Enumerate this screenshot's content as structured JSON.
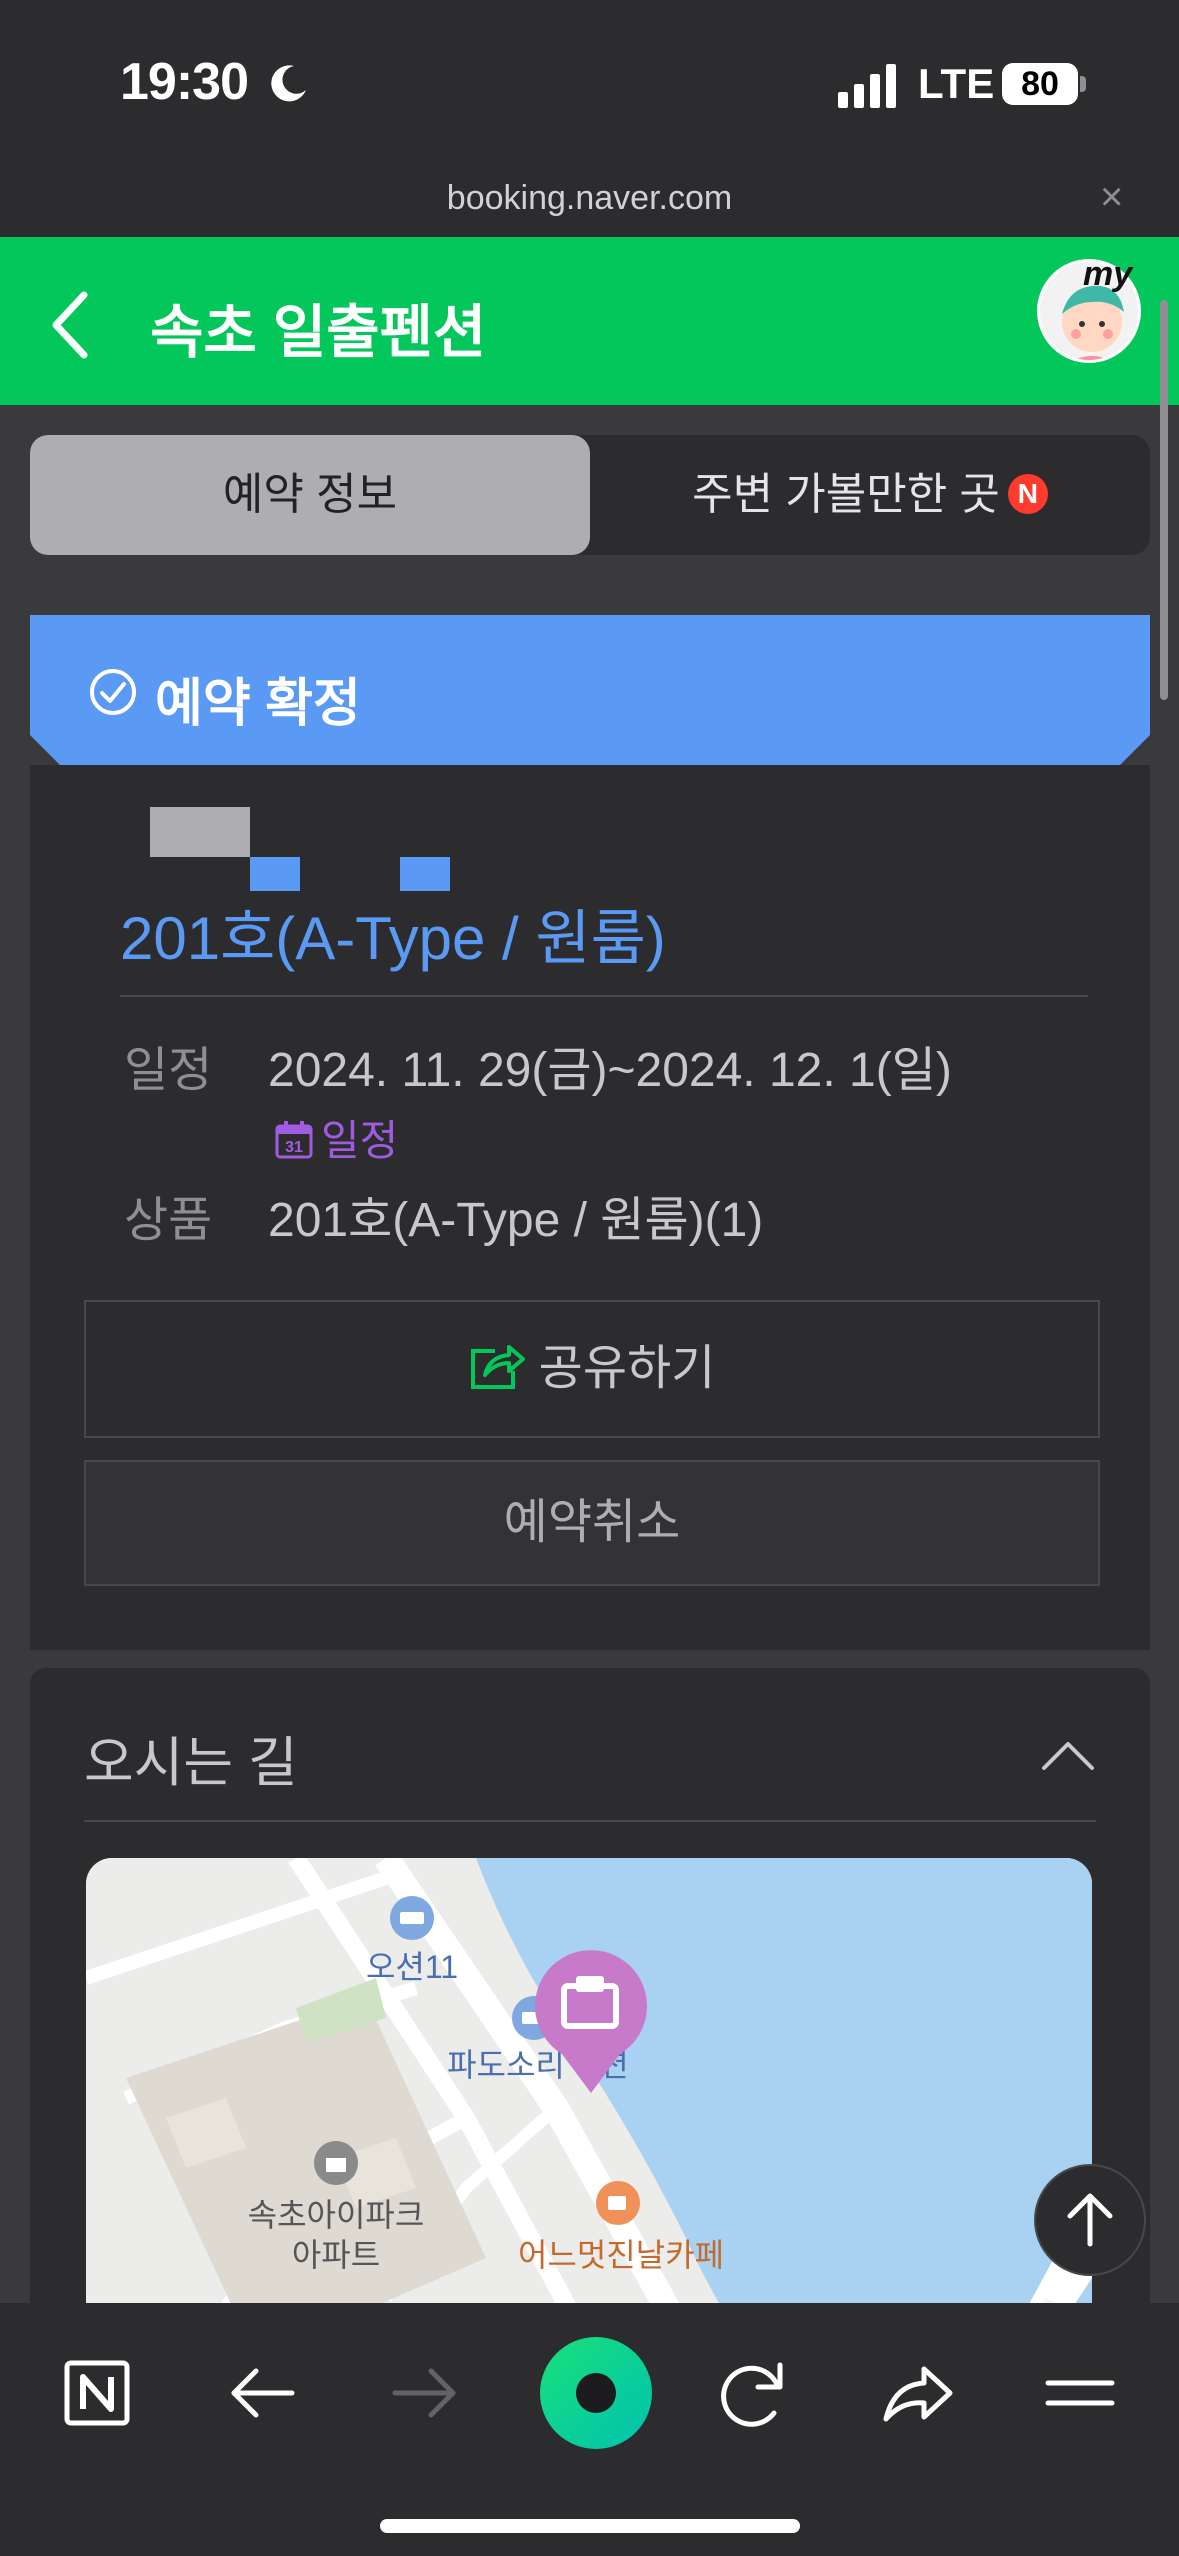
{
  "status_bar": {
    "time": "19:30",
    "network": "LTE",
    "battery": "80"
  },
  "browser": {
    "url": "booking.naver.com",
    "close_label": "×"
  },
  "header": {
    "title": "속초 일출펜션",
    "avatar_badge": "my"
  },
  "tabs": [
    {
      "label": "예약 정보",
      "active": true
    },
    {
      "label": "주변 가볼만한 곳",
      "active": false,
      "badge": "N"
    }
  ],
  "status_banner": {
    "label": "예약 확정",
    "color": "#5a9af5"
  },
  "booking": {
    "room_title": "201호(A-Type / 원룸)",
    "schedule_label": "일정",
    "schedule_value": "2024. 11. 29(금)~2024. 12. 1(일)",
    "calendar_link": "일정",
    "calendar_day": "31",
    "product_label": "상품",
    "product_value": "201호(A-Type / 원룸)(1)",
    "share_button": "공유하기",
    "cancel_button": "예약취소"
  },
  "directions": {
    "title": "오시는 길",
    "map_labels": {
      "poi1": "오션11",
      "poi2": "파도소리",
      "poi2_suffix": "션",
      "apt_line1": "속초아이파크",
      "apt_line2": "아파트",
      "cafe": "어느멋진날카페"
    }
  },
  "colors": {
    "accent_green": "#03c75a",
    "confirm_blue": "#5a9af5",
    "calendar_purple": "#a05ce0"
  }
}
